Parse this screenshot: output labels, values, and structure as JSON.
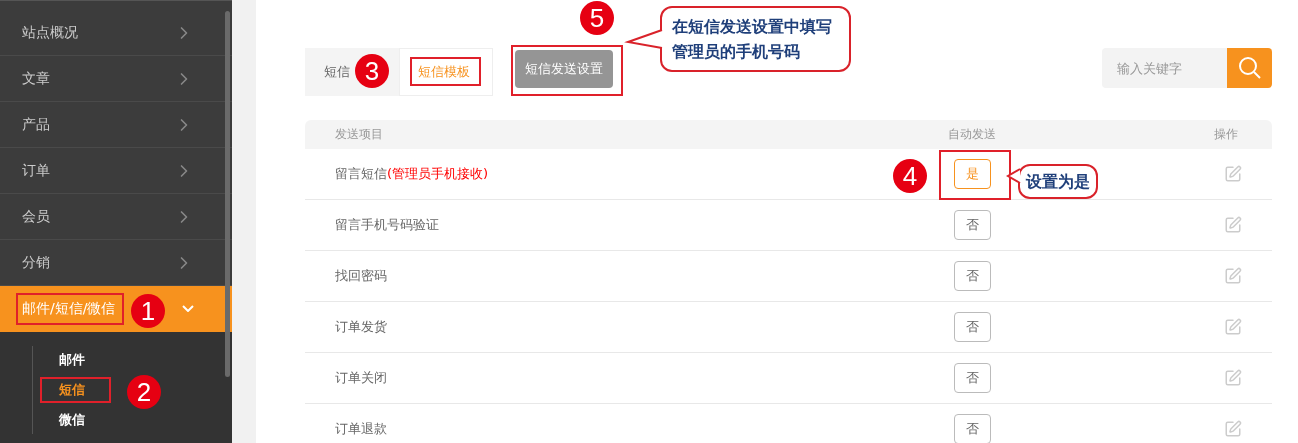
{
  "sidebar": {
    "items": [
      {
        "label": "站点概况",
        "selected": false,
        "expanded": false
      },
      {
        "label": "文章",
        "selected": false,
        "expanded": false
      },
      {
        "label": "产品",
        "selected": false,
        "expanded": false
      },
      {
        "label": "订单",
        "selected": false,
        "expanded": false
      },
      {
        "label": "会员",
        "selected": false,
        "expanded": false
      },
      {
        "label": "分销",
        "selected": false,
        "expanded": false
      },
      {
        "label": "邮件/短信/微信",
        "selected": true,
        "expanded": true,
        "children": [
          {
            "label": "邮件",
            "selected": false
          },
          {
            "label": "短信",
            "selected": true
          },
          {
            "label": "微信",
            "selected": false
          }
        ]
      }
    ]
  },
  "tabs": [
    {
      "label": "短信",
      "selected": false
    },
    {
      "label": "短信模板",
      "selected": true
    }
  ],
  "settings_button": "短信发送设置",
  "search": {
    "placeholder": "输入关键字"
  },
  "table": {
    "columns": [
      "发送项目",
      "自动发送",
      "操作"
    ],
    "rows": [
      {
        "item": "留言短信",
        "note": "(管理员手机接收)",
        "auto_send": "是",
        "on": true
      },
      {
        "item": "留言手机号码验证",
        "auto_send": "否",
        "on": false
      },
      {
        "item": "找回密码",
        "auto_send": "否",
        "on": false
      },
      {
        "item": "订单发货",
        "auto_send": "否",
        "on": false
      },
      {
        "item": "订单关闭",
        "auto_send": "否",
        "on": false
      },
      {
        "item": "订单退款",
        "auto_send": "否",
        "on": false
      }
    ]
  },
  "markers": [
    "1",
    "2",
    "3",
    "4",
    "5"
  ],
  "callouts": [
    "在短信发送设置中填写管理员的手机号码",
    "设置为是"
  ]
}
